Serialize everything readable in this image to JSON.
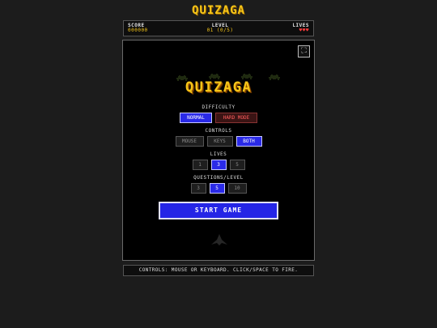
{
  "page": {
    "title": "QUIZAGA"
  },
  "hud": {
    "score_label": "SCORE",
    "score_value": "000000",
    "level_label": "LEVEL",
    "level_value": "01 (0/5)",
    "lives_label": "LIVES",
    "lives_hearts": "♥♥♥"
  },
  "game": {
    "logo": "QUIZAGA",
    "fullscreen_icon": "fullscreen-icon",
    "difficulty": {
      "label": "DIFFICULTY",
      "options": [
        "NORMAL",
        "HARD MODE"
      ],
      "selected": "NORMAL"
    },
    "controls": {
      "label": "CONTROLS",
      "options": [
        "MOUSE",
        "KEYS",
        "BOTH"
      ],
      "selected": "BOTH"
    },
    "lives": {
      "label": "LIVES",
      "options": [
        "1",
        "3",
        "5"
      ],
      "selected": "3"
    },
    "questions": {
      "label": "QUESTIONS/LEVEL",
      "options": [
        "3",
        "5",
        "10"
      ],
      "selected": "5"
    },
    "start_label": "START GAME"
  },
  "footer": {
    "controls_text": "CONTROLS: MOUSE OR KEYBOARD. CLICK/SPACE TO FIRE."
  },
  "colors": {
    "accent_gold": "#f5c518",
    "selected_blue": "#2a2ae8",
    "hard_red": "#ff5c5c",
    "heart_red": "#ff3b3b",
    "background": "#1c1c1c"
  }
}
